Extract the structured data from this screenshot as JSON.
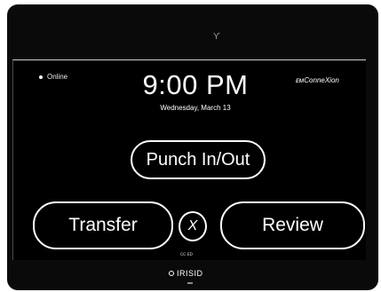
{
  "device": {
    "camera_glyph": "Ƴ",
    "footer_small": "ᴄᴄ ᴇᴅ",
    "logo_text": "IRISID",
    "logo_icon": "ring-icon"
  },
  "status": {
    "text": "Online",
    "indicator_color": "#ffffff"
  },
  "clock": {
    "time": "9:00 PM",
    "date": "Wednesday, March 13"
  },
  "brand": {
    "text": "ConneXion",
    "prefix": "ᴇᴍ"
  },
  "buttons": {
    "punch": "Punch In/Out",
    "transfer": "Transfer",
    "review": "Review",
    "close_glyph": "X"
  },
  "colors": {
    "background": "#000000",
    "foreground": "#ffffff"
  }
}
